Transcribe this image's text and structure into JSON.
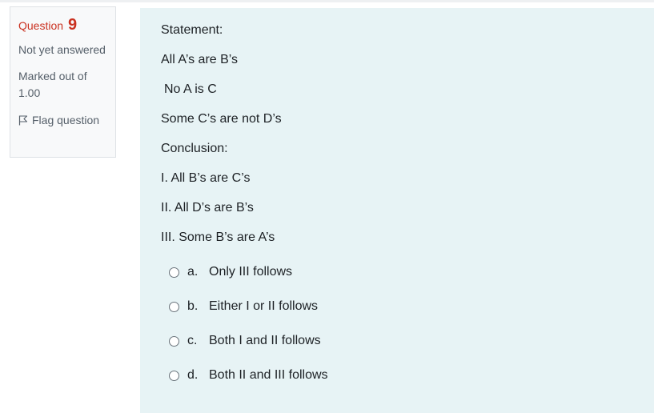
{
  "info": {
    "question_label": "Question",
    "question_number": "9",
    "state": "Not yet answered",
    "grade_line1": "Marked out of",
    "grade_line2": "1.00",
    "flag_label": "Flag question"
  },
  "question": {
    "lines": [
      "Statement:",
      "All A’s are B’s",
      "No A is C",
      "Some C’s are not D’s",
      "Conclusion:",
      "I. All B’s are C’s",
      "II. All D’s are B’s",
      "III. Some B’s are A’s"
    ],
    "options": [
      {
        "letter": "a.",
        "text": "Only III follows"
      },
      {
        "letter": "b.",
        "text": "Either I or II follows"
      },
      {
        "letter": "c.",
        "text": "Both I and II follows"
      },
      {
        "letter": "d.",
        "text": "Both II and III follows"
      }
    ]
  },
  "colors": {
    "question_number": "#ca3120",
    "formulation_bg": "#e7f3f5",
    "info_bg": "#f8f9fa"
  }
}
